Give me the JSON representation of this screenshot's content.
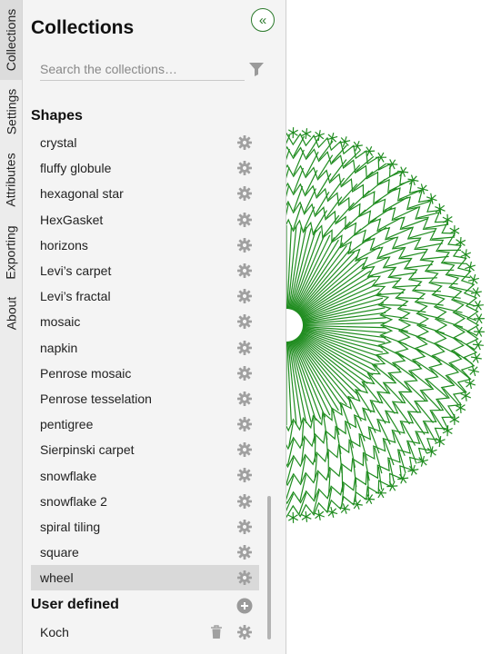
{
  "tabs": [
    {
      "label": "Collections",
      "active": true
    },
    {
      "label": "Settings",
      "active": false
    },
    {
      "label": "Attributes",
      "active": false
    },
    {
      "label": "Exporting",
      "active": false
    },
    {
      "label": "About",
      "active": false
    }
  ],
  "panel": {
    "title": "Collections",
    "collapse_label": "«",
    "search": {
      "placeholder": "Search the collections…",
      "value": ""
    }
  },
  "shapes": {
    "title": "Shapes",
    "items": [
      {
        "label": "crystal"
      },
      {
        "label": "fluffy globule"
      },
      {
        "label": "hexagonal star"
      },
      {
        "label": "HexGasket"
      },
      {
        "label": "horizons"
      },
      {
        "label": "Levi’s carpet"
      },
      {
        "label": "Levi’s fractal"
      },
      {
        "label": "mosaic"
      },
      {
        "label": "napkin"
      },
      {
        "label": "Penrose mosaic"
      },
      {
        "label": "Penrose tesselation"
      },
      {
        "label": "pentigree"
      },
      {
        "label": "Sierpinski carpet"
      },
      {
        "label": "snowflake"
      },
      {
        "label": "snowflake 2"
      },
      {
        "label": "spiral tiling"
      },
      {
        "label": "square"
      },
      {
        "label": "wheel",
        "selected": true
      }
    ]
  },
  "user_defined": {
    "title": "User defined",
    "items": [
      {
        "label": "Koch"
      }
    ]
  },
  "colors": {
    "accent": "#2c7a2c",
    "fractal_stroke": "#1f8c1f",
    "selected_row": "#d9d9d9",
    "icon_gray": "#9a9a9a"
  },
  "icons": {
    "collapse": "double-chevron-left-icon",
    "filter": "filter-icon",
    "settings": "gear-icon",
    "add": "plus-circle-icon",
    "delete": "trash-icon"
  }
}
